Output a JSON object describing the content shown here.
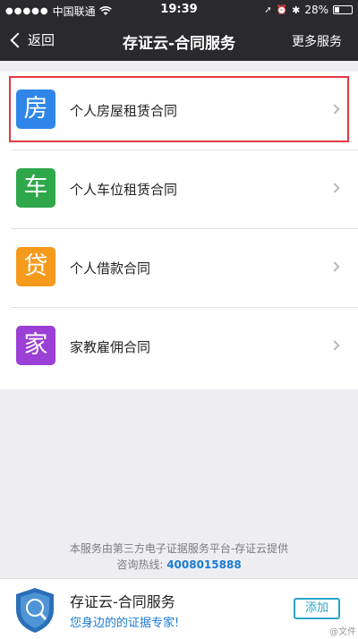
{
  "status_bar": {
    "carrier": "中国联通",
    "time": "19:39",
    "battery": "28%",
    "icons": [
      "signal-dots",
      "wifi-icon",
      "location-icon",
      "alarm-icon",
      "bluetooth-icon",
      "battery-icon"
    ]
  },
  "nav": {
    "back_label": "返回",
    "title": "存证云-合同服务",
    "more_label": "更多服务"
  },
  "items": [
    {
      "char": "房",
      "label": "个人房屋租赁合同",
      "color": "#2f86e8",
      "highlighted": true
    },
    {
      "char": "车",
      "label": "个人车位租赁合同",
      "color": "#2ea84a",
      "highlighted": false
    },
    {
      "char": "贷",
      "label": "个人借款合同",
      "color": "#f59a1b",
      "highlighted": false
    },
    {
      "char": "家",
      "label": "家教雇佣合同",
      "color": "#9b3fd6",
      "highlighted": false
    }
  ],
  "footer": {
    "line1": "本服务由第三方电子证据服务平台-存证云提供",
    "hotline_label": "咨询热线:",
    "hotline_number": "4008015888"
  },
  "banner": {
    "app_name": "存证云-合同服务",
    "slogan": "您身边的的证据专家!",
    "add_label": "添加",
    "watermark": "@文件"
  },
  "colors": {
    "bar_bg": "#2a2a2e",
    "highlight": "#e03a3e",
    "accent": "#1a7bd6",
    "add_button": "#28a6c8"
  }
}
